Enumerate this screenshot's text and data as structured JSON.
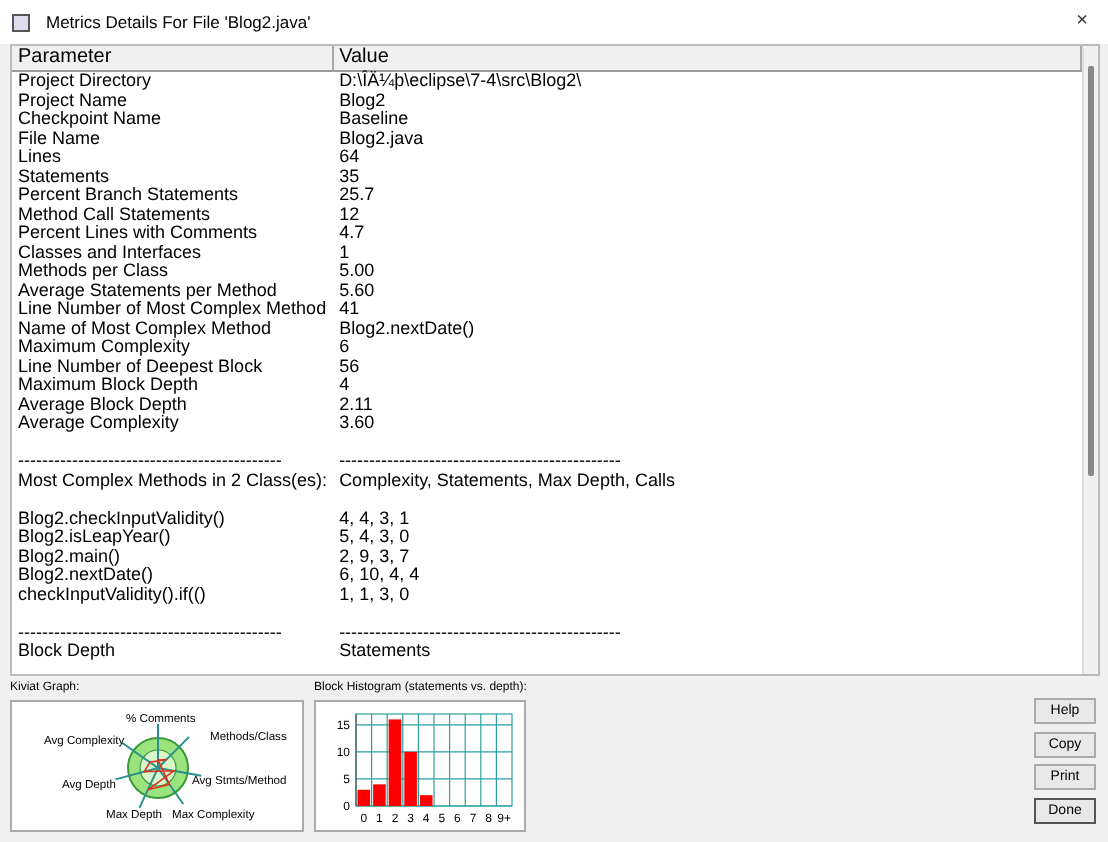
{
  "window": {
    "title": "Metrics Details For File 'Blog2.java'",
    "close": "×"
  },
  "table": {
    "columns": [
      "Parameter",
      "Value"
    ],
    "rows": [
      {
        "kind": "pair",
        "parameter": "Project Directory",
        "value": "D:\\ÎÄ¼þ\\eclipse\\7-4\\src\\Blog2\\"
      },
      {
        "kind": "pair",
        "parameter": "Project Name",
        "value": "Blog2"
      },
      {
        "kind": "pair",
        "parameter": "Checkpoint Name",
        "value": "Baseline"
      },
      {
        "kind": "pair",
        "parameter": "File Name",
        "value": "Blog2.java"
      },
      {
        "kind": "pair",
        "parameter": "Lines",
        "value": "64"
      },
      {
        "kind": "pair",
        "parameter": "Statements",
        "value": "35"
      },
      {
        "kind": "pair",
        "parameter": "Percent Branch Statements",
        "value": "25.7"
      },
      {
        "kind": "pair",
        "parameter": "Method Call Statements",
        "value": "12"
      },
      {
        "kind": "pair",
        "parameter": "Percent Lines with Comments",
        "value": "4.7"
      },
      {
        "kind": "pair",
        "parameter": "Classes and Interfaces",
        "value": "1"
      },
      {
        "kind": "pair",
        "parameter": "Methods per Class",
        "value": "5.00"
      },
      {
        "kind": "pair",
        "parameter": "Average Statements per Method",
        "value": "5.60"
      },
      {
        "kind": "pair",
        "parameter": "Line Number of Most Complex Method",
        "value": "41"
      },
      {
        "kind": "pair",
        "parameter": "Name of Most Complex Method",
        "value": "Blog2.nextDate()"
      },
      {
        "kind": "pair",
        "parameter": "Maximum Complexity",
        "value": "6"
      },
      {
        "kind": "pair",
        "parameter": "Line Number of Deepest Block",
        "value": "56"
      },
      {
        "kind": "pair",
        "parameter": "Maximum Block Depth",
        "value": "4"
      },
      {
        "kind": "pair",
        "parameter": "Average Block Depth",
        "value": "2.11"
      },
      {
        "kind": "pair",
        "parameter": "Average Complexity",
        "value": "3.60"
      },
      {
        "kind": "blank"
      },
      {
        "kind": "pair",
        "parameter": "--------------------------------------------",
        "value": "-----------------------------------------------"
      },
      {
        "kind": "pair",
        "parameter": "Most Complex Methods in 2 Class(es):",
        "value": "Complexity, Statements, Max Depth, Calls"
      },
      {
        "kind": "blank"
      },
      {
        "kind": "pair",
        "parameter": "Blog2.checkInputValidity()",
        "value": "4, 4, 3, 1"
      },
      {
        "kind": "pair",
        "parameter": "Blog2.isLeapYear()",
        "value": "5, 4, 3, 0"
      },
      {
        "kind": "pair",
        "parameter": "Blog2.main()",
        "value": "2, 9, 3, 7"
      },
      {
        "kind": "pair",
        "parameter": "Blog2.nextDate()",
        "value": "6, 10, 4, 4"
      },
      {
        "kind": "pair",
        "parameter": "checkInputValidity().if(()",
        "value": "1, 1, 3, 0"
      },
      {
        "kind": "blank"
      },
      {
        "kind": "pair",
        "parameter": "--------------------------------------------",
        "value": "-----------------------------------------------"
      },
      {
        "kind": "pair",
        "parameter": "Block Depth",
        "value": "Statements"
      }
    ]
  },
  "kiviat": {
    "label": "Kiviat Graph:",
    "axes": [
      "% Comments",
      "Methods/Class",
      "Avg Complexity",
      "Avg Depth",
      "Avg Stmts/Method",
      "Max Depth",
      "Max Complexity"
    ]
  },
  "histogram": {
    "label": "Block Histogram (statements vs. depth):",
    "chart_data": {
      "type": "bar",
      "categories": [
        "0",
        "1",
        "2",
        "3",
        "4",
        "5",
        "6",
        "7",
        "8",
        "9+"
      ],
      "values": [
        3,
        4,
        16,
        10,
        2,
        0,
        0,
        0,
        0,
        0
      ],
      "ylim": [
        0,
        17
      ],
      "yticks": [
        0,
        5,
        10,
        15
      ],
      "grid": true
    }
  },
  "buttons": [
    "Help",
    "Copy",
    "Print",
    "Done"
  ]
}
